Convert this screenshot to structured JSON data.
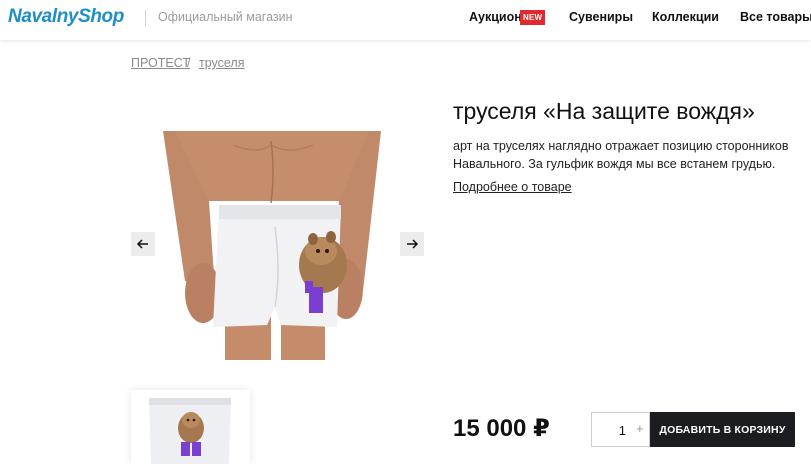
{
  "header": {
    "logo": "NavalnyShop",
    "tagline": "Официальный магазин",
    "nav": {
      "auction": "Аукцион",
      "auction_badge": "NEW",
      "souvenirs": "Сувениры",
      "collections": "Коллекции",
      "all_products": "Все товары"
    }
  },
  "breadcrumb": {
    "items": [
      "ПРОТЕСТ",
      "труселя"
    ],
    "separator": "/"
  },
  "product": {
    "title": "труселя «На защите вождя»",
    "description": "арт на труселях наглядно отражает позицию сторонников Навального. За гульфик вождя мы все встанем грудью.",
    "more_link": "Подробнее о товаре",
    "price": "15 000 ₽",
    "quantity": "1",
    "quantity_plus": "+",
    "add_to_cart": "ДОБАВИТЬ В КОРЗИНУ"
  },
  "icons": {
    "prev": "arrow-left-icon",
    "next": "arrow-right-icon"
  },
  "colors": {
    "logo": "#1f8fc8",
    "badge": "#e0282e",
    "button": "#1b1d20",
    "accent_purple": "#7a3fd1"
  }
}
